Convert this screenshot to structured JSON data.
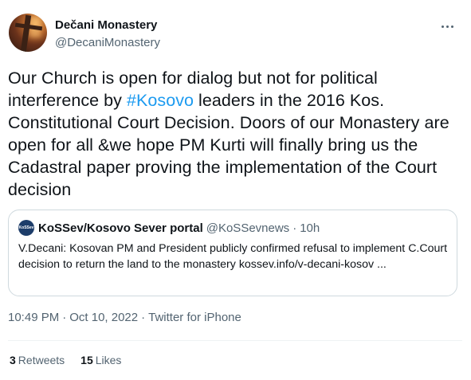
{
  "author": {
    "display_name": "Dečani Monastery",
    "handle": "@DecaniMonastery"
  },
  "tweet": {
    "text_before_hashtag": "Our Church is open for dialog but not for political interference by ",
    "hashtag": "#Kosovo",
    "text_after_hashtag": " leaders in the 2016 Kos. Constitutional Court Decision. Doors of our Monastery are open for all &we hope PM Kurti will finally bring us the Cadastral paper proving the implementation of the Court decision"
  },
  "quote": {
    "logo_text": "KoSSev",
    "name": "KoSSev/Kosovo Sever portal",
    "handle": "@KoSSevnews",
    "separator": "·",
    "time": "10h",
    "text": "V.Decani: Kosovan PM and President publicly confirmed refusal to implement C.Court decision to return the land to the monastery kossev.info/v-decani-kosov ..."
  },
  "meta": {
    "time": "10:49 PM",
    "separator": "·",
    "date": "Oct 10, 2022",
    "source": "Twitter for iPhone"
  },
  "stats": {
    "retweets_count": "3",
    "retweets_label": "Retweets",
    "likes_count": "15",
    "likes_label": "Likes"
  },
  "colors": {
    "accent": "#1d9bf0",
    "text": "#0f1419",
    "secondary": "#536471",
    "border": "#cfd9de"
  }
}
